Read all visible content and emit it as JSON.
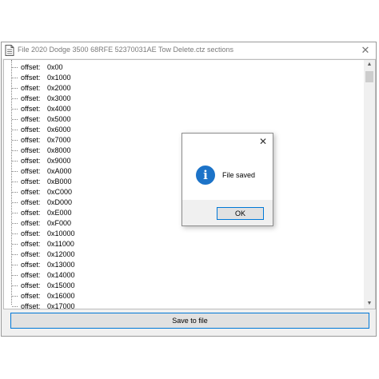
{
  "window": {
    "title": "File 2020 Dodge 3500 68RFE 52370031AE Tow Delete.ctz sections",
    "close_glyph": "✕"
  },
  "tree": {
    "label": "offset:",
    "items": [
      "0x00",
      "0x1000",
      "0x2000",
      "0x3000",
      "0x4000",
      "0x5000",
      "0x6000",
      "0x7000",
      "0x8000",
      "0x9000",
      "0xA000",
      "0xB000",
      "0xC000",
      "0xD000",
      "0xE000",
      "0xF000",
      "0x10000",
      "0x11000",
      "0x12000",
      "0x13000",
      "0x14000",
      "0x15000",
      "0x16000",
      "0x17000"
    ]
  },
  "scrollbar": {
    "up_glyph": "▲",
    "down_glyph": "▼"
  },
  "footer": {
    "save_label": "Save to file"
  },
  "dialog": {
    "close_glyph": "✕",
    "icon_glyph": "i",
    "message": "File saved",
    "ok_label": "OK"
  },
  "colors": {
    "accent": "#0078d7",
    "info_icon": "#1c73c8"
  }
}
